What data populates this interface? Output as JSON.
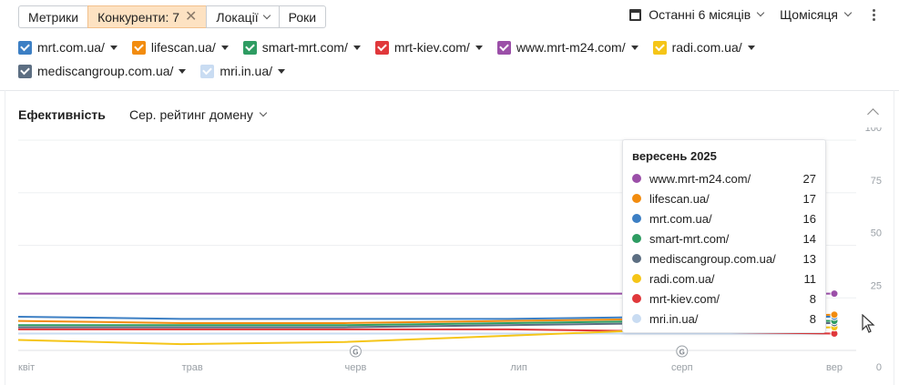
{
  "toolbar": {
    "metrics_label": "Метрики",
    "competitors_label": "Конкуренти: 7",
    "locations_label": "Локації",
    "years_label": "Роки"
  },
  "controls": {
    "period_label": "Останні 6 місяців",
    "granularity_label": "Щомісяця"
  },
  "legend": [
    {
      "label": "mrt.com.ua/",
      "color": "#3c7fc4"
    },
    {
      "label": "lifescan.ua/",
      "color": "#f28c0f"
    },
    {
      "label": "smart-mrt.com/",
      "color": "#2e9c62"
    },
    {
      "label": "mrt-kiev.com/",
      "color": "#e0383b"
    },
    {
      "label": "www.mrt-m24.com/",
      "color": "#9b4fa8"
    },
    {
      "label": "radi.com.ua/",
      "color": "#f5c518"
    },
    {
      "label": "mediscangroup.com.ua/",
      "color": "#5c6e82"
    },
    {
      "label": "mri.in.ua/",
      "color": "#c9dcf2"
    }
  ],
  "section": {
    "title": "Ефективність",
    "metric_label": "Сер. рейтинг домену"
  },
  "tooltip": {
    "title": "вересень 2025",
    "rows": [
      {
        "name": "www.mrt-m24.com/",
        "value": "27",
        "color": "#9b4fa8"
      },
      {
        "name": "lifescan.ua/",
        "value": "17",
        "color": "#f28c0f"
      },
      {
        "name": "mrt.com.ua/",
        "value": "16",
        "color": "#3c7fc4"
      },
      {
        "name": "smart-mrt.com/",
        "value": "14",
        "color": "#2e9c62"
      },
      {
        "name": "mediscangroup.com.ua/",
        "value": "13",
        "color": "#5c6e82"
      },
      {
        "name": "radi.com.ua/",
        "value": "11",
        "color": "#f5c518"
      },
      {
        "name": "mrt-kiev.com/",
        "value": "8",
        "color": "#e0383b"
      },
      {
        "name": "mri.in.ua/",
        "value": "8",
        "color": "#c9dcf2"
      }
    ]
  },
  "chart_data": {
    "type": "line",
    "x": [
      "квіт",
      "трав",
      "черв",
      "лип",
      "серп",
      "вер"
    ],
    "ylim": [
      0,
      100
    ],
    "yticks": [
      0,
      25,
      50,
      75,
      100
    ],
    "annotations": [
      {
        "x_index": 2,
        "label": "G"
      },
      {
        "x_index": 4,
        "label": "G"
      }
    ],
    "series": [
      {
        "name": "www.mrt-m24.com/",
        "color": "#9b4fa8",
        "values": [
          27,
          27,
          27,
          27,
          27,
          27
        ]
      },
      {
        "name": "lifescan.ua/",
        "color": "#f28c0f",
        "values": [
          14,
          13,
          13,
          14,
          15,
          17
        ]
      },
      {
        "name": "mrt.com.ua/",
        "color": "#3c7fc4",
        "values": [
          16,
          15,
          15,
          15,
          16,
          16
        ]
      },
      {
        "name": "smart-mrt.com/",
        "color": "#2e9c62",
        "values": [
          12,
          12,
          12,
          13,
          14,
          14
        ]
      },
      {
        "name": "mediscangroup.com.ua/",
        "color": "#5c6e82",
        "values": [
          11,
          11,
          11,
          12,
          13,
          13
        ]
      },
      {
        "name": "radi.com.ua/",
        "color": "#f5c518",
        "values": [
          5,
          3,
          4,
          7,
          10,
          11
        ]
      },
      {
        "name": "mrt-kiev.com/",
        "color": "#e0383b",
        "values": [
          10,
          10,
          10,
          10,
          9,
          8
        ]
      },
      {
        "name": "mri.in.ua/",
        "color": "#c9dcf2",
        "values": [
          8,
          8,
          8,
          8,
          8,
          8
        ]
      }
    ]
  }
}
